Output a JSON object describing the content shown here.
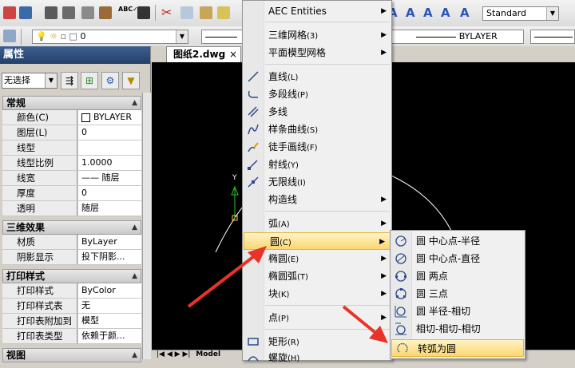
{
  "toolbar": {
    "textstyle": "Standard",
    "layer_name": "0",
    "linetype": "BYLAYER"
  },
  "properties": {
    "title": "属性",
    "selection": "无选择",
    "sections": [
      {
        "title": "常规",
        "rows": [
          {
            "key": "颜色(C)",
            "value": "BYLAYER"
          },
          {
            "key": "图层(L)",
            "value": "0"
          },
          {
            "key": "线型",
            "value": ""
          },
          {
            "key": "线型比例",
            "value": "1.0000"
          },
          {
            "key": "线宽",
            "value": "—— 随层"
          },
          {
            "key": "厚度",
            "value": "0"
          },
          {
            "key": "透明",
            "value": "随层"
          }
        ]
      },
      {
        "title": "三维效果",
        "rows": [
          {
            "key": "材质",
            "value": "ByLayer"
          },
          {
            "key": "阴影显示",
            "value": "投下阴影..."
          }
        ]
      },
      {
        "title": "打印样式",
        "rows": [
          {
            "key": "打印样式",
            "value": "ByColor"
          },
          {
            "key": "打印样式表",
            "value": "无"
          },
          {
            "key": "打印表附加到",
            "value": "模型"
          },
          {
            "key": "打印表类型",
            "value": "依赖于颜..."
          }
        ]
      },
      {
        "title": "视图",
        "rows": []
      }
    ]
  },
  "document": {
    "tab": "图纸2.dwg",
    "close": "×",
    "model_tab": "Model",
    "axis_y": "Y"
  },
  "draw_menu": [
    {
      "label": "AEC Entities",
      "submenu": true
    },
    {
      "label": "三维网格",
      "key": "(3)",
      "submenu": true
    },
    {
      "label": "平面模型网格",
      "submenu": true
    },
    {
      "label": "直线",
      "key": "(L)"
    },
    {
      "label": "多段线",
      "key": "(P)"
    },
    {
      "label": "多线"
    },
    {
      "label": "样条曲线",
      "key": "(S)"
    },
    {
      "label": "徒手画线",
      "key": "(F)"
    },
    {
      "label": "射线",
      "key": "(Y)"
    },
    {
      "label": "无限线",
      "key": "(I)"
    },
    {
      "label": "构造线",
      "submenu": true
    },
    {
      "label": "弧",
      "key": "(A)",
      "submenu": true
    },
    {
      "label": "圆",
      "key": "(C)",
      "submenu": true
    },
    {
      "label": "椭圆",
      "key": "(E)",
      "submenu": true
    },
    {
      "label": "椭圆弧",
      "key": "(T)",
      "submenu": true
    },
    {
      "label": "块",
      "key": "(K)",
      "submenu": true
    },
    {
      "label": "点",
      "key": "(P)",
      "submenu": true
    },
    {
      "label": "矩形",
      "key": "(R)"
    },
    {
      "label": "螺旋",
      "key": "(H)"
    }
  ],
  "circle_submenu": [
    "圆 中心点-半径",
    "圆 中心点-直径",
    "圆 两点",
    "圆 三点",
    "圆 半径-相切",
    "相切-相切-相切",
    "转弧为圆"
  ],
  "colors": {
    "highlight": "#fbd773",
    "arrow": "#e8332a",
    "panel_title": "#2b4a7a"
  }
}
